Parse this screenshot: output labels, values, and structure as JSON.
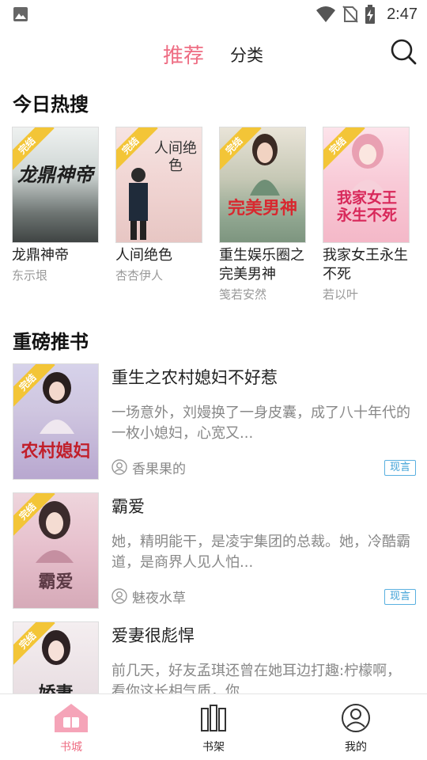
{
  "status_bar": {
    "time": "2:47"
  },
  "header": {
    "tab_recommend": "推荐",
    "tab_category": "分类"
  },
  "sections": {
    "hot_title": "今日热搜",
    "recommend_title": "重磅推书"
  },
  "badge_text": "完结",
  "hot_books": [
    {
      "name": "龙鼎神帝",
      "author": "东示垠",
      "cover_title": "龙鼎神帝"
    },
    {
      "name": "人间绝色",
      "author": "杏杏伊人",
      "cover_title": "人间绝色"
    },
    {
      "name": "重生娱乐圈之完美男神",
      "author": "笺若安然",
      "cover_title": "完美男神"
    },
    {
      "name": "我家女王永生不死",
      "author": "若以叶",
      "cover_title": "我家女王永生不死"
    }
  ],
  "recommend_books": [
    {
      "title": "重生之农村媳妇不好惹",
      "desc": "一场意外，刘嫚换了一身皮囊，成了八十年代的一枚小媳妇，心宽又...",
      "author": "香果果的",
      "tag": "现言",
      "cover_title": "农村媳妇"
    },
    {
      "title": "霸爱",
      "desc": "她，精明能干，是凌宇集团的总裁。她，冷酷霸道，是商界人见人怕...",
      "author": "魅夜水草",
      "tag": "现言",
      "cover_title": "霸爱"
    },
    {
      "title": "爱妻很彪悍",
      "desc": "前几天，好友孟琪还曾在她耳边打趣:柠檬啊，看你这长相气质，你...",
      "author": "",
      "tag": "",
      "cover_title": "娇妻"
    }
  ],
  "bottom_nav": {
    "bookstore": "书城",
    "bookshelf": "书架",
    "mine": "我的"
  },
  "colors": {
    "accent": "#ee6d83",
    "badge": "#f3c537",
    "tag": "#3b9fd6"
  }
}
